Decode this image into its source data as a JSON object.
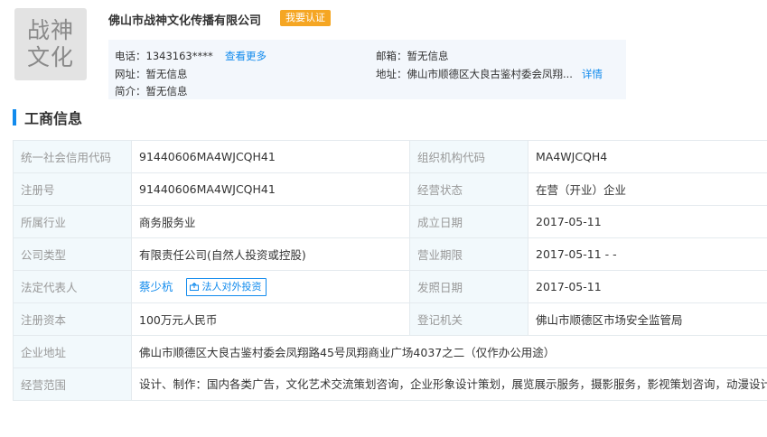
{
  "company": {
    "logo_line1": "战神",
    "logo_line2": "文化",
    "name": "佛山市战神文化传播有限公司",
    "verify_label": "我要认证"
  },
  "contact": {
    "phone": "电话：1343163****",
    "more_link": "查看更多",
    "email": "邮箱：暂无信息",
    "website": "网址：暂无信息",
    "address": "地址：佛山市顺德区大良古鉴村委会凤翔...",
    "detail_link": "详情",
    "intro": "简介：暂无信息"
  },
  "section_title": "工商信息",
  "business": {
    "credit_code_label": "统一社会信用代码",
    "credit_code": "91440606MA4WJCQH41",
    "org_code_label": "组织机构代码",
    "org_code": "MA4WJCQH4",
    "reg_no_label": "注册号",
    "reg_no": "91440606MA4WJCQH41",
    "status_label": "经营状态",
    "status": "在营（开业）企业",
    "industry_label": "所属行业",
    "industry": "商务服务业",
    "founded_label": "成立日期",
    "founded": "2017-05-11",
    "type_label": "公司类型",
    "type": "有限责任公司(自然人投资或控股)",
    "term_label": "营业期限",
    "term": "2017-05-11 - -",
    "legal_rep_label": "法定代表人",
    "legal_rep": "蔡少杭",
    "invest_tag": "法人对外投资",
    "issue_date_label": "发照日期",
    "issue_date": "2017-05-11",
    "capital_label": "注册资本",
    "capital": "100万元人民币",
    "authority_label": "登记机关",
    "authority": "佛山市顺德区市场安全监管局",
    "address_label": "企业地址",
    "address": "佛山市顺德区大良古鉴村委会凤翔路45号凤翔商业广场4037之二（仅作办公用途）",
    "scope_label": "经营范围",
    "scope": "设计、制作：国内各类广告，文化艺术交流策划咨询，企业形象设计策划，展览展示服务，摄影服务，影视策划咨询，动漫设计，平面设计，互联网信息服务，网络多媒体制作策划咨询，多媒体设备租赁；销售：摄影器材；国内商业、物资供销业。"
  },
  "colors": {
    "link": "#128bed",
    "badge": "#f5a623",
    "label_bg": "#f2f9fc",
    "info_bg": "#f3f7fc"
  }
}
